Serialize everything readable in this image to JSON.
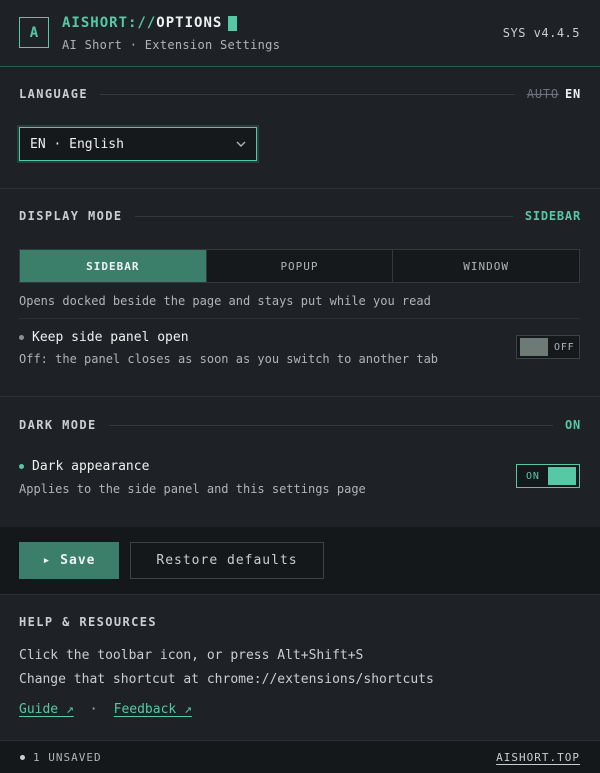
{
  "header": {
    "logo_letter": "A",
    "brand_prefix": "AISHORT://",
    "brand_suffix": "OPTIONS",
    "subtitle": "AI Short · Extension Settings",
    "version": "SYS v4.4.5"
  },
  "language": {
    "title": "LANGUAGE",
    "status_old": "AUTO",
    "status_new": "EN",
    "select_value": "EN · English"
  },
  "display_mode": {
    "title": "DISPLAY MODE",
    "status": "SIDEBAR",
    "tabs": [
      "SIDEBAR",
      "POPUP",
      "WINDOW"
    ],
    "description": "Opens docked beside the page and stays put while you read",
    "keep_open_title": "Keep side panel open",
    "keep_open_note": "Off: the panel closes as soon as you switch to another tab",
    "keep_open_toggle": "OFF"
  },
  "dark_mode": {
    "title": "DARK MODE",
    "status": "ON",
    "option_title": "Dark appearance",
    "option_note": "Applies to the side panel and this settings page",
    "toggle": "ON"
  },
  "actions": {
    "save_label": "▸ Save",
    "restore_label": "Restore defaults"
  },
  "help": {
    "title": "HELP & RESOURCES",
    "line1": "Click the toolbar icon, or press Alt+Shift+S",
    "line2": "Change that shortcut at chrome://extensions/shortcuts",
    "guide_label": "Guide ↗",
    "separator": "·",
    "feedback_label": "Feedback ↗"
  },
  "footer": {
    "unsaved": "1 UNSAVED",
    "domain": "AISHORT.TOP"
  },
  "colors": {
    "accent": "#56c8a4",
    "accent_dark": "#3b7f6a",
    "background": "#1e2226"
  }
}
